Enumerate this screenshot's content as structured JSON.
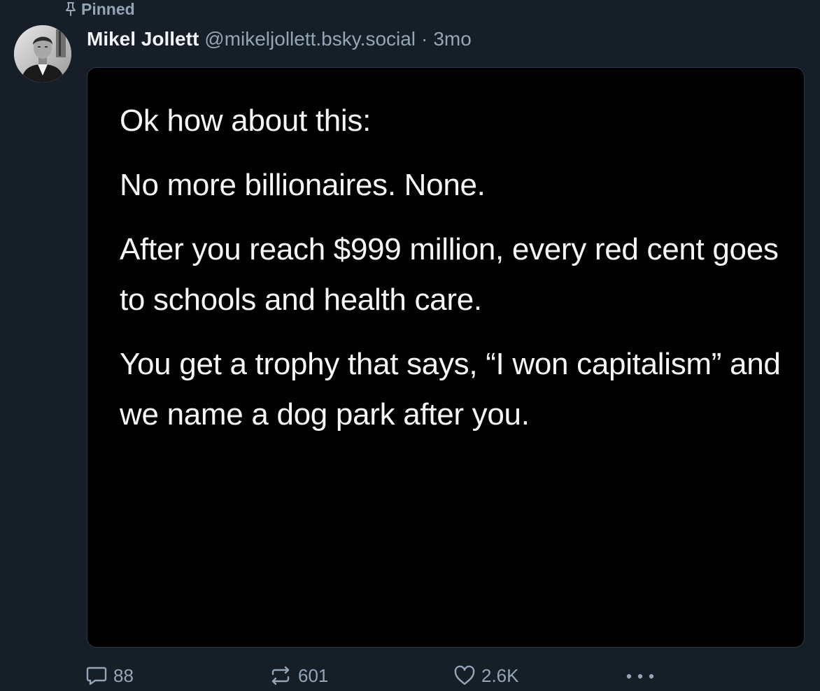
{
  "pinned": {
    "label": "Pinned",
    "icon": "pin-icon"
  },
  "author": {
    "display_name": "Mikel Jollett",
    "handle": "@mikeljollett.bsky.social",
    "separator": "·",
    "timestamp": "3mo",
    "avatar": "avatar-photo"
  },
  "embed": {
    "paragraphs": [
      "Ok how about this:",
      "No more billionaires. None.",
      "After you reach $999 million, every red cent goes to schools and health care.",
      "You get a trophy that says, “I won capitalism” and we name a dog park after you."
    ]
  },
  "actions": {
    "reply": {
      "count": "88",
      "icon": "reply-bubble-icon"
    },
    "repost": {
      "count": "601",
      "icon": "repost-icon"
    },
    "like": {
      "count": "2.6K",
      "icon": "heart-icon"
    },
    "more": {
      "icon": "more-horizontal-icon"
    }
  },
  "colors": {
    "background": "#161e27",
    "muted": "#93a5b7",
    "text": "#f1f3f5",
    "image_background": "#000000"
  }
}
